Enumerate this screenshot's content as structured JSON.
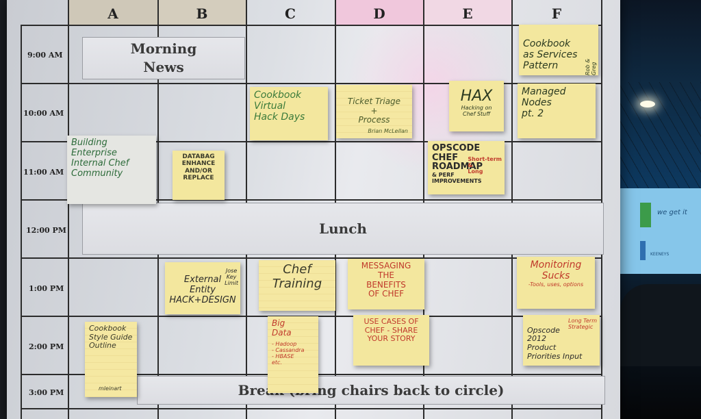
{
  "columns": [
    "A",
    "B",
    "C",
    "D",
    "E",
    "F"
  ],
  "times": [
    "9:00 AM",
    "10:00 AM",
    "11:00 AM",
    "12:00 PM",
    "1:00 PM",
    "2:00 PM",
    "3:00 PM"
  ],
  "bands": {
    "morning_news": "Morning\nNews",
    "lunch": "Lunch",
    "break": "Break (bring chairs back to circle)"
  },
  "notes": {
    "cookbook_services": "Cookbook\nas Services\nPattern",
    "cookbook_services_side": "Rob & Greg",
    "cookbook_virtual": "Cookbook\nVirtual\nHack Days",
    "ticket_triage": "Ticket Triage\n+\nProcess",
    "ticket_triage_by": "Brian McLellan",
    "hax": "HAX",
    "hax_sub": "Hacking on\nChef Stuff",
    "managed_nodes": "Managed\nNodes\npt. 2",
    "building_community": "Building Enterprise\nInternal Chef\nCommunity",
    "databag": "DATABAG\nENHANCE\nAND/OR\nREPLACE",
    "opscode_roadmap": "OPSCODE\nCHEF\nROADMAP",
    "opscode_roadmap_side": "Short-term\n&\nLong",
    "opscode_roadmap_sub": "& PERF IMPROVEMENTS",
    "external_entity": "External\nEntity\nHACK+DESIGN",
    "external_entity_side": "Jose\nKey\nLimit",
    "chef_training": "Chef\nTraining",
    "messaging": "MESSAGING\nTHE\nBENEFITS\nOF CHEF",
    "monitoring": "Monitoring\nSucks",
    "monitoring_sub": "-Tools, uses, options",
    "use_cases": "USE CASES OF\nCHEF - SHARE\nYOUR STORY",
    "cookbook_style": "Cookbook\nStyle Guide\nOutline",
    "cookbook_style_by": "mleinart",
    "big_data": "Big\nData",
    "big_data_list": "- Hadoop\n- Cassandra\n- HBASE\netc.",
    "opscode_2012": "Opscode\n2012\nProduct\nPriorities Input",
    "opscode_2012_side": "Long Term\nStrategic"
  },
  "scene": {
    "truck_text": "we get it",
    "truck_small": "KEENEYS"
  }
}
